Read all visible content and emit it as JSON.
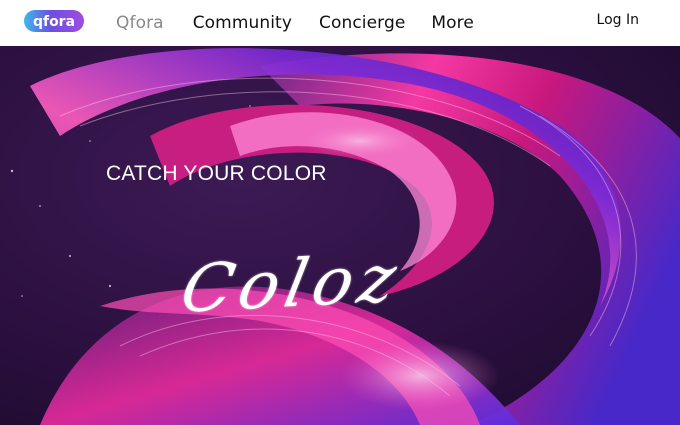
{
  "brand": {
    "logo_text": "qfora",
    "logo_color": "#7b3fe4"
  },
  "nav": {
    "items": [
      {
        "label": "Qfora"
      },
      {
        "label": "Community"
      },
      {
        "label": "Concierge"
      },
      {
        "label": "More"
      }
    ],
    "login_label": "Log In"
  },
  "hero": {
    "tagline": "CATCH YOUR COLOR",
    "script_text": "Coloz",
    "colors": {
      "background": "#2a0f3e",
      "magenta": "#e0208a",
      "violet": "#5a32d8",
      "pink": "#ff6fc8"
    }
  }
}
